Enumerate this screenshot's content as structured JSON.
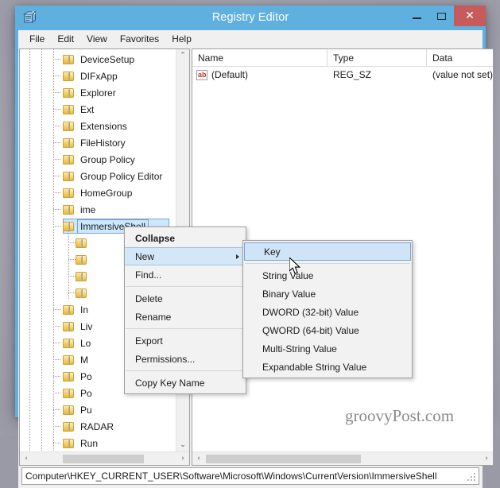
{
  "window": {
    "title": "Registry Editor",
    "app_icon": "registry-editor-icon",
    "minimize_label": "Minimize",
    "maximize_label": "Maximize",
    "close_label": "Close",
    "accent_color": "#5fb0de",
    "close_button_color": "#c75b5b"
  },
  "menubar": {
    "items": [
      {
        "label": "File"
      },
      {
        "label": "Edit"
      },
      {
        "label": "View"
      },
      {
        "label": "Favorites"
      },
      {
        "label": "Help"
      }
    ]
  },
  "tree": {
    "selected_key": "ImmersiveShell",
    "items": [
      {
        "label": "DeviceSetup",
        "expandable": false,
        "depth": 1
      },
      {
        "label": "DIFxApp",
        "expandable": true,
        "depth": 1
      },
      {
        "label": "Explorer",
        "expandable": true,
        "depth": 1
      },
      {
        "label": "Ext",
        "expandable": true,
        "depth": 1
      },
      {
        "label": "Extensions",
        "expandable": false,
        "depth": 1
      },
      {
        "label": "FileHistory",
        "expandable": true,
        "depth": 1
      },
      {
        "label": "Group Policy",
        "expandable": true,
        "depth": 1
      },
      {
        "label": "Group Policy Editor",
        "expandable": true,
        "depth": 1
      },
      {
        "label": "HomeGroup",
        "expandable": true,
        "depth": 1
      },
      {
        "label": "ime",
        "expandable": true,
        "depth": 1
      },
      {
        "label": "ImmersiveShell",
        "expandable": true,
        "expanded": true,
        "depth": 1,
        "selected": true
      },
      {
        "label": "",
        "expandable": false,
        "depth": 2
      },
      {
        "label": "",
        "expandable": false,
        "depth": 2
      },
      {
        "label": "",
        "expandable": true,
        "depth": 2
      },
      {
        "label": "",
        "expandable": false,
        "depth": 2
      },
      {
        "label": "In",
        "expandable": true,
        "depth": 1
      },
      {
        "label": "Liv",
        "expandable": true,
        "depth": 1
      },
      {
        "label": "Lo",
        "expandable": false,
        "depth": 1
      },
      {
        "label": "M",
        "expandable": true,
        "depth": 1
      },
      {
        "label": "Po",
        "expandable": false,
        "depth": 1
      },
      {
        "label": "Po",
        "expandable": false,
        "depth": 1
      },
      {
        "label": "Pu",
        "expandable": false,
        "depth": 1
      },
      {
        "label": "RADAR",
        "expandable": false,
        "depth": 1
      },
      {
        "label": "Run",
        "expandable": false,
        "depth": 1
      }
    ]
  },
  "list": {
    "columns": [
      {
        "label": "Name"
      },
      {
        "label": "Type"
      },
      {
        "label": "Data"
      }
    ],
    "rows": [
      {
        "name": "(Default)",
        "type": "REG_SZ",
        "data": "(value not set)",
        "icon": "string-value-icon"
      }
    ]
  },
  "context_menu": {
    "items": [
      {
        "label": "Collapse",
        "bold": true
      },
      {
        "label": "New",
        "has_submenu": true,
        "highlighted": true
      },
      {
        "label": "Find..."
      },
      {
        "separator_after": true
      },
      {
        "label": "Delete"
      },
      {
        "label": "Rename"
      },
      {
        "separator_after2": true
      },
      {
        "label": "Export"
      },
      {
        "label": "Permissions..."
      },
      {
        "label": "Copy Key Name"
      }
    ],
    "labels": {
      "collapse": "Collapse",
      "new": "New",
      "find": "Find...",
      "delete": "Delete",
      "rename": "Rename",
      "export": "Export",
      "permissions": "Permissions...",
      "copy_key_name": "Copy Key Name"
    }
  },
  "submenu": {
    "highlighted": "Key",
    "items": [
      {
        "label": "Key",
        "highlighted": true
      },
      {
        "label": "String Value"
      },
      {
        "label": "Binary Value"
      },
      {
        "label": "DWORD (32-bit) Value"
      },
      {
        "label": "QWORD (64-bit) Value"
      },
      {
        "label": "Multi-String Value"
      },
      {
        "label": "Expandable String Value"
      }
    ]
  },
  "statusbar": {
    "path": "Computer\\HKEY_CURRENT_USER\\Software\\Microsoft\\Windows\\CurrentVersion\\ImmersiveShell"
  },
  "scrollbars": {
    "tree_up_arrow": "⌃",
    "tree_down_arrow": "⌄",
    "tree_left_arrow": "‹",
    "tree_right_arrow": "›",
    "list_left_arrow": "‹",
    "list_right_arrow": "›"
  },
  "watermark": {
    "text": "groovyPost.com"
  }
}
